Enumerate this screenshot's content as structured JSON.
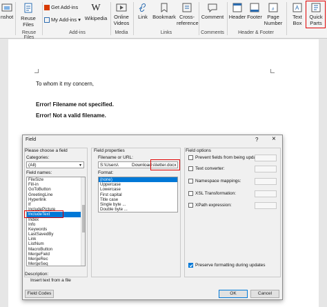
{
  "ribbon": {
    "screenshot": "nshot",
    "reuse_files": "Reuse Files",
    "reuse_files_group": "Reuse Files",
    "get_addins": "Get Add-ins",
    "my_addins": "My Add-ins",
    "wikipedia": "Wikipedia",
    "addins_group": "Add-ins",
    "online_videos_1": "Online",
    "online_videos_2": "Videos",
    "media_group": "Media",
    "link": "Link",
    "bookmark": "Bookmark",
    "cross_reference_1": "Cross-",
    "cross_reference_2": "reference",
    "links_group": "Links",
    "comment": "Comment",
    "comments_group": "Comments",
    "header": "Header",
    "footer": "Footer",
    "page_number_1": "Page",
    "page_number_2": "Number",
    "header_footer_group": "Header & Footer",
    "text_box_1": "Text",
    "text_box_2": "Box",
    "quick_parts_1": "Quick",
    "quick_parts_2": "Parts"
  },
  "document": {
    "line1": "To whom it my concern,",
    "line2": "Error! Filename not specified.",
    "line3": "Error! Not a valid filename."
  },
  "dialog": {
    "title": "Field",
    "help": "?",
    "close": "×",
    "choose_field": "Please choose a field",
    "categories_label": "Categories:",
    "categories_value": "(All)",
    "field_names_label": "Field names:",
    "field_names": [
      "FileSize",
      "Fill-in",
      "GoToButton",
      "GreetingLine",
      "Hyperlink",
      "If",
      "IncludePicture",
      "IncludeText",
      "Index",
      "Info",
      "Keywords",
      "LastSavedBy",
      "Link",
      "ListNum",
      "MacroButton",
      "MergeField",
      "MergeRec",
      "MergeSeq"
    ],
    "selected_field": "IncludeText",
    "field_properties": "Field properties",
    "filename_label": "Filename or URL:",
    "filename_value": "S:\\Users\\",
    "filename_suffix": "Download",
    "filename_boxed": "s\\letter.docx",
    "format_label": "Format:",
    "formats": [
      "(none)",
      "Uppercase",
      "Lowercase",
      "First capital",
      "Title case",
      "Single byte ...",
      "Double byte ..."
    ],
    "selected_format": "(none)",
    "field_options": "Field options",
    "options": [
      "Prevent fields from being updated",
      "Text converter:",
      "Namespace mappings:",
      "XSL Transformation:",
      "XPath expression:"
    ],
    "preserve": "Preserve formatting during updates",
    "description_label": "Description:",
    "description_text": "Insert text from a file",
    "field_codes": "Field Codes",
    "ok": "OK",
    "cancel": "Cancel"
  }
}
